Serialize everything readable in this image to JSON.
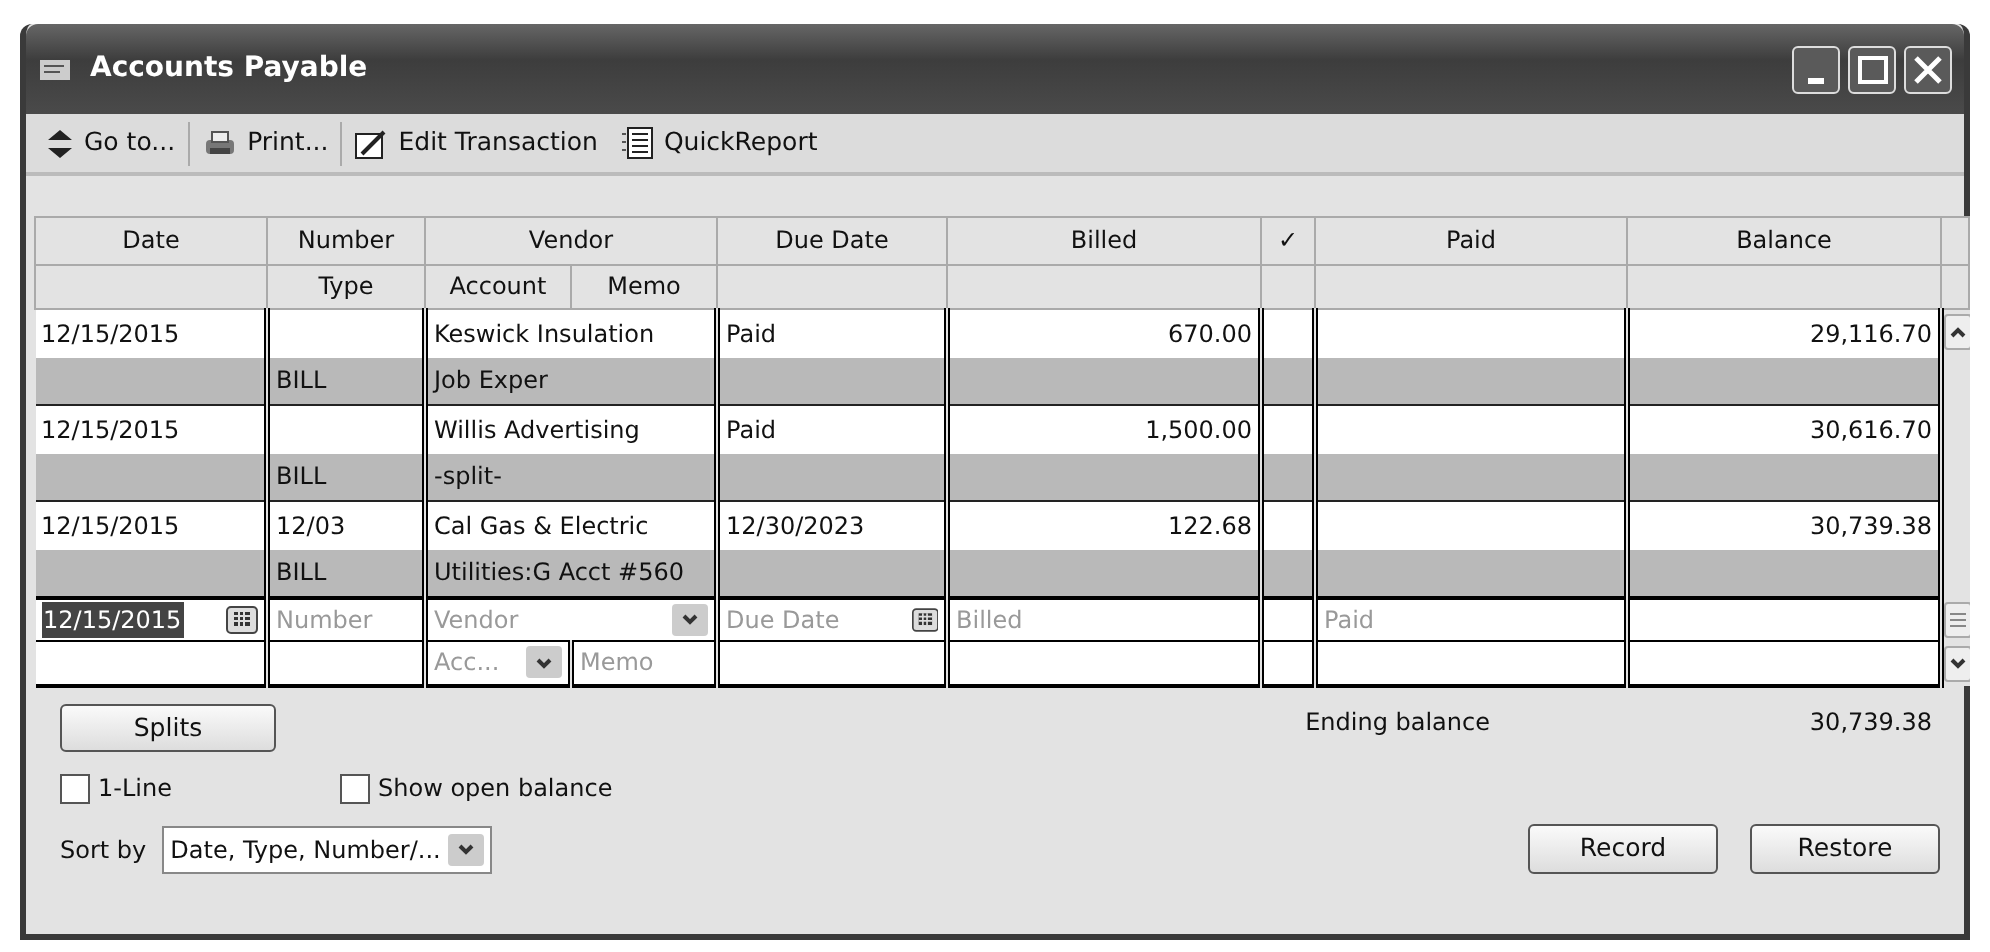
{
  "window": {
    "title": "Accounts Payable"
  },
  "toolbar": [
    {
      "kind": "goto",
      "label": "Go to..."
    },
    {
      "kind": "print",
      "label": "Print..."
    },
    {
      "kind": "edit",
      "label": "Edit Transaction"
    },
    {
      "kind": "report",
      "label": "QuickReport"
    }
  ],
  "header": {
    "row_1": [
      "Date",
      "Number",
      "Vendor",
      "Due Date",
      "Billed",
      "✓",
      "Paid",
      "Balance"
    ],
    "row_2": {
      "type": "Type",
      "account": "Account",
      "memo": "Memo"
    }
  },
  "transactions": [
    {
      "date": "12/15/2015",
      "vendor": "Keswick Insulation",
      "due_date": "Paid",
      "billed": "670.00",
      "balance": "29,116.70",
      "type": "BILL",
      "account": "Job Exper"
    },
    {
      "date": "12/15/2015",
      "vendor": "Willis Advertising",
      "due_date": "Paid",
      "billed": "1,500.00",
      "balance": "30,616.70",
      "type": "BILL",
      "account": "-split-"
    },
    {
      "date": "12/15/2015",
      "number": "12/03",
      "vendor": "Cal Gas & Electric",
      "due_date": "12/30/2023",
      "billed": "122.68",
      "balance": "30,739.38",
      "type": "BILL",
      "account": "Utilities:G",
      "memo": "Acct #560"
    }
  ],
  "entry": {
    "date": "12/15/2015",
    "number": {
      "placeholder": "Number"
    },
    "vendor": {
      "placeholder": "Vendor"
    },
    "due_date": {
      "placeholder": "Due Date"
    },
    "billed": {
      "placeholder": "Billed"
    },
    "paid": {
      "placeholder": "Paid"
    },
    "account": {
      "placeholder": "Acc..."
    },
    "memo": {
      "placeholder": "Memo"
    }
  },
  "footer": {
    "splits_button": "Splits",
    "ending_balance_label": "Ending balance",
    "ending_balance": "30,739.38",
    "checkboxes": [
      {
        "label": "1-Line",
        "checked": false
      },
      {
        "label": "Show open balance",
        "checked": false
      }
    ],
    "sort_label": "Sort by",
    "sort_value": "Date, Type, Number/...",
    "buttons": [
      "Record",
      "Restore"
    ]
  }
}
